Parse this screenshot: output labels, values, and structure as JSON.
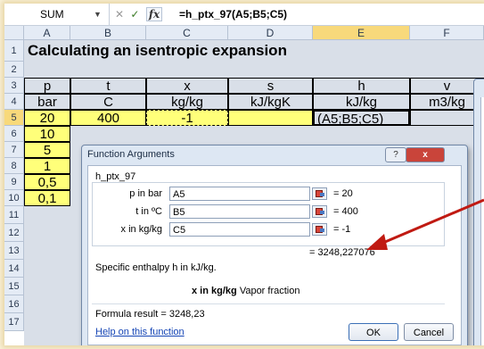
{
  "formula_bar": {
    "name_box": "SUM",
    "dropdown_icon": "chevron-down-icon",
    "cancel_glyph": "✕",
    "confirm_glyph": "✓",
    "fx_glyph": "fx",
    "formula": "=h_ptx_97(A5;B5;C5)"
  },
  "columns": [
    "A",
    "B",
    "C",
    "D",
    "E",
    "F"
  ],
  "rows": [
    "1",
    "2",
    "3",
    "4",
    "5",
    "6",
    "7",
    "8",
    "9",
    "10",
    "11",
    "12",
    "13",
    "14",
    "15",
    "16",
    "17"
  ],
  "sheet": {
    "title": "Calculating an isentropic expansion",
    "headers": [
      "p",
      "t",
      "x",
      "s",
      "h",
      "v"
    ],
    "units": [
      "bar",
      "C",
      "kg/kg",
      "kJ/kgK",
      "kJ/kg",
      "m3/kg"
    ],
    "row5": [
      "20",
      "400",
      "-1",
      "",
      "(A5;B5;C5)",
      ""
    ],
    "pressures": [
      "10",
      "5",
      "1",
      "0,5",
      "0,1"
    ]
  },
  "colors": {
    "accent_yellow": "#ffff7a",
    "arrow_red": "#c01a12",
    "selection": "#f8d97b"
  },
  "dialog": {
    "title": "Function Arguments",
    "help_glyph": "?",
    "close_glyph": "x",
    "function_name": "h_ptx_97",
    "args": [
      {
        "label": "p in bar",
        "value": "A5",
        "result": "= 20"
      },
      {
        "label": "t in ºC",
        "value": "B5",
        "result": "= 400"
      },
      {
        "label": "x in kg/kg",
        "value": "C5",
        "result": "= -1"
      }
    ],
    "total_result": "= 3248,227076",
    "description": "Specific enthalpy h in kJ/kg.",
    "arg_name": "x in kg/kg",
    "arg_desc": "Vapor fraction",
    "formula_result": "Formula result = 3248,23",
    "help_link": "Help on this function",
    "ok": "OK",
    "cancel": "Cancel"
  }
}
